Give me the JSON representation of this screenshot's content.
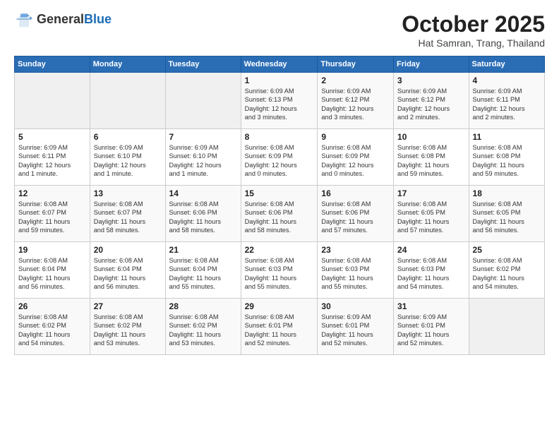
{
  "header": {
    "logo_general": "General",
    "logo_blue": "Blue",
    "month": "October 2025",
    "location": "Hat Samran, Trang, Thailand"
  },
  "days_of_week": [
    "Sunday",
    "Monday",
    "Tuesday",
    "Wednesday",
    "Thursday",
    "Friday",
    "Saturday"
  ],
  "weeks": [
    [
      {
        "day": "",
        "info": ""
      },
      {
        "day": "",
        "info": ""
      },
      {
        "day": "",
        "info": ""
      },
      {
        "day": "1",
        "info": "Sunrise: 6:09 AM\nSunset: 6:13 PM\nDaylight: 12 hours\nand 3 minutes."
      },
      {
        "day": "2",
        "info": "Sunrise: 6:09 AM\nSunset: 6:12 PM\nDaylight: 12 hours\nand 3 minutes."
      },
      {
        "day": "3",
        "info": "Sunrise: 6:09 AM\nSunset: 6:12 PM\nDaylight: 12 hours\nand 2 minutes."
      },
      {
        "day": "4",
        "info": "Sunrise: 6:09 AM\nSunset: 6:11 PM\nDaylight: 12 hours\nand 2 minutes."
      }
    ],
    [
      {
        "day": "5",
        "info": "Sunrise: 6:09 AM\nSunset: 6:11 PM\nDaylight: 12 hours\nand 1 minute."
      },
      {
        "day": "6",
        "info": "Sunrise: 6:09 AM\nSunset: 6:10 PM\nDaylight: 12 hours\nand 1 minute."
      },
      {
        "day": "7",
        "info": "Sunrise: 6:09 AM\nSunset: 6:10 PM\nDaylight: 12 hours\nand 1 minute."
      },
      {
        "day": "8",
        "info": "Sunrise: 6:08 AM\nSunset: 6:09 PM\nDaylight: 12 hours\nand 0 minutes."
      },
      {
        "day": "9",
        "info": "Sunrise: 6:08 AM\nSunset: 6:09 PM\nDaylight: 12 hours\nand 0 minutes."
      },
      {
        "day": "10",
        "info": "Sunrise: 6:08 AM\nSunset: 6:08 PM\nDaylight: 11 hours\nand 59 minutes."
      },
      {
        "day": "11",
        "info": "Sunrise: 6:08 AM\nSunset: 6:08 PM\nDaylight: 11 hours\nand 59 minutes."
      }
    ],
    [
      {
        "day": "12",
        "info": "Sunrise: 6:08 AM\nSunset: 6:07 PM\nDaylight: 11 hours\nand 59 minutes."
      },
      {
        "day": "13",
        "info": "Sunrise: 6:08 AM\nSunset: 6:07 PM\nDaylight: 11 hours\nand 58 minutes."
      },
      {
        "day": "14",
        "info": "Sunrise: 6:08 AM\nSunset: 6:06 PM\nDaylight: 11 hours\nand 58 minutes."
      },
      {
        "day": "15",
        "info": "Sunrise: 6:08 AM\nSunset: 6:06 PM\nDaylight: 11 hours\nand 58 minutes."
      },
      {
        "day": "16",
        "info": "Sunrise: 6:08 AM\nSunset: 6:06 PM\nDaylight: 11 hours\nand 57 minutes."
      },
      {
        "day": "17",
        "info": "Sunrise: 6:08 AM\nSunset: 6:05 PM\nDaylight: 11 hours\nand 57 minutes."
      },
      {
        "day": "18",
        "info": "Sunrise: 6:08 AM\nSunset: 6:05 PM\nDaylight: 11 hours\nand 56 minutes."
      }
    ],
    [
      {
        "day": "19",
        "info": "Sunrise: 6:08 AM\nSunset: 6:04 PM\nDaylight: 11 hours\nand 56 minutes."
      },
      {
        "day": "20",
        "info": "Sunrise: 6:08 AM\nSunset: 6:04 PM\nDaylight: 11 hours\nand 56 minutes."
      },
      {
        "day": "21",
        "info": "Sunrise: 6:08 AM\nSunset: 6:04 PM\nDaylight: 11 hours\nand 55 minutes."
      },
      {
        "day": "22",
        "info": "Sunrise: 6:08 AM\nSunset: 6:03 PM\nDaylight: 11 hours\nand 55 minutes."
      },
      {
        "day": "23",
        "info": "Sunrise: 6:08 AM\nSunset: 6:03 PM\nDaylight: 11 hours\nand 55 minutes."
      },
      {
        "day": "24",
        "info": "Sunrise: 6:08 AM\nSunset: 6:03 PM\nDaylight: 11 hours\nand 54 minutes."
      },
      {
        "day": "25",
        "info": "Sunrise: 6:08 AM\nSunset: 6:02 PM\nDaylight: 11 hours\nand 54 minutes."
      }
    ],
    [
      {
        "day": "26",
        "info": "Sunrise: 6:08 AM\nSunset: 6:02 PM\nDaylight: 11 hours\nand 54 minutes."
      },
      {
        "day": "27",
        "info": "Sunrise: 6:08 AM\nSunset: 6:02 PM\nDaylight: 11 hours\nand 53 minutes."
      },
      {
        "day": "28",
        "info": "Sunrise: 6:08 AM\nSunset: 6:02 PM\nDaylight: 11 hours\nand 53 minutes."
      },
      {
        "day": "29",
        "info": "Sunrise: 6:08 AM\nSunset: 6:01 PM\nDaylight: 11 hours\nand 52 minutes."
      },
      {
        "day": "30",
        "info": "Sunrise: 6:09 AM\nSunset: 6:01 PM\nDaylight: 11 hours\nand 52 minutes."
      },
      {
        "day": "31",
        "info": "Sunrise: 6:09 AM\nSunset: 6:01 PM\nDaylight: 11 hours\nand 52 minutes."
      },
      {
        "day": "",
        "info": ""
      }
    ]
  ]
}
